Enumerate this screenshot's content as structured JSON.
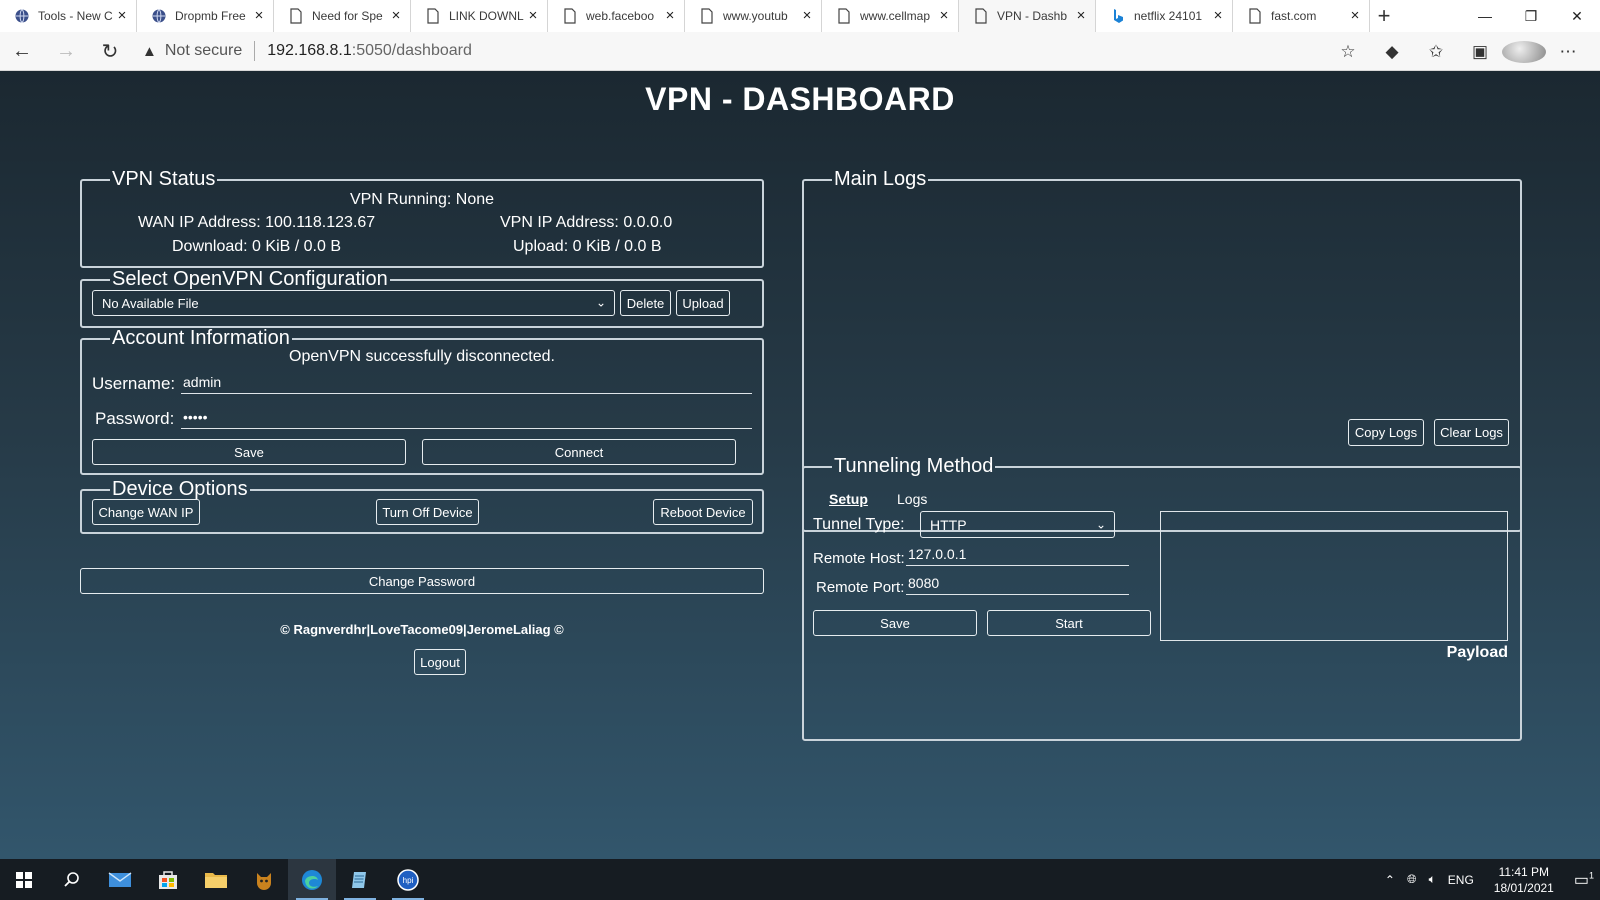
{
  "browser": {
    "tabs": [
      {
        "label": "Tools - New C",
        "icon": "vpn-globe-icon",
        "active": false
      },
      {
        "label": "Dropmb Free",
        "icon": "vpn-globe-icon",
        "active": false
      },
      {
        "label": "Need for Spe",
        "icon": "page-icon",
        "active": false
      },
      {
        "label": "LINK DOWNL",
        "icon": "page-icon",
        "active": false
      },
      {
        "label": "web.faceboo",
        "icon": "page-icon",
        "active": false
      },
      {
        "label": "www.youtub",
        "icon": "page-icon",
        "active": false
      },
      {
        "label": "www.cellmap",
        "icon": "page-icon",
        "active": false
      },
      {
        "label": "VPN - Dashb",
        "icon": "page-icon",
        "active": true
      },
      {
        "label": "netflix 24101",
        "icon": "bing-icon",
        "active": false
      },
      {
        "label": "fast.com",
        "icon": "page-icon",
        "active": false
      }
    ],
    "security_label": "Not secure",
    "url_host": "192.168.8.1",
    "url_path": ":5050/dashboard"
  },
  "dashboard": {
    "title": "VPN - DASHBOARD",
    "vpn_status": {
      "legend": "VPN Status",
      "running": "VPN Running: None",
      "wan_ip": "WAN IP Address: 100.118.123.67",
      "vpn_ip": "VPN IP Address: 0.0.0.0",
      "download": "Download: 0 KiB / 0.0 B",
      "upload": "Upload: 0 KiB / 0.0 B"
    },
    "config": {
      "legend": "Select OpenVPN Configuration",
      "selected": "No Available File",
      "delete_label": "Delete",
      "upload_label": "Upload"
    },
    "account": {
      "legend": "Account Information",
      "message": "OpenVPN successfully disconnected.",
      "username_label": "Username:",
      "username_value": "admin",
      "password_label": "Password:",
      "password_value": "•••••",
      "save_label": "Save",
      "connect_label": "Connect"
    },
    "device": {
      "legend": "Device Options",
      "change_wan_label": "Change WAN IP",
      "turn_off_label": "Turn Off Device",
      "reboot_label": "Reboot Device"
    },
    "change_password_label": "Change Password",
    "credit": "© Ragnverdhr|LoveTacome09|JeromeLaliag ©",
    "logout_label": "Logout",
    "logs": {
      "legend": "Main Logs",
      "copy_label": "Copy Logs",
      "clear_label": "Clear Logs"
    },
    "tunnel": {
      "legend": "Tunneling Method",
      "tab_setup": "Setup",
      "tab_logs": "Logs",
      "type_label": "Tunnel Type:",
      "type_value": "HTTP",
      "host_label": "Remote Host:",
      "host_value": "127.0.0.1",
      "port_label": "Remote Port:",
      "port_value": "8080",
      "save_label": "Save",
      "start_label": "Start",
      "payload_label": "Payload"
    }
  },
  "taskbar": {
    "language": "ENG",
    "time": "11:41 PM",
    "date": "18/01/2021",
    "notification_count": "1"
  }
}
